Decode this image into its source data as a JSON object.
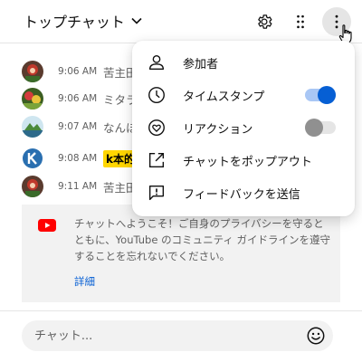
{
  "header": {
    "title": "トップチャット",
    "icons": [
      "chevron-down-icon",
      "gear-icon",
      "apps-grid-icon",
      "more-vert-icon"
    ]
  },
  "messages": [
    {
      "time": "9:06 AM",
      "author": "苦主田"
    },
    {
      "time": "9:06 AM",
      "author": "ミタラ"
    },
    {
      "time": "9:07 AM",
      "author": "なんほ"
    },
    {
      "time": "9:08 AM",
      "author": "k本的"
    },
    {
      "time": "9:11 AM",
      "author": "苦主田"
    }
  ],
  "welcome": {
    "text": "チャットへようこそ！ご自身のプライバシーを守るとともに、YouTube のコミュニティ ガイドラインを遵守することを忘れないでください。",
    "details_link": "詳細"
  },
  "input": {
    "placeholder": "チャット..."
  },
  "menu": {
    "items": [
      {
        "label": "参加者",
        "icon": "person-icon"
      },
      {
        "label": "タイムスタンプ",
        "icon": "clock-icon",
        "toggle": true
      },
      {
        "label": "リアクション",
        "icon": "heart-icon",
        "toggle": false
      },
      {
        "label": "チャットをポップアウト",
        "icon": "popout-icon"
      },
      {
        "label": "フィードバックを送信",
        "icon": "feedback-icon"
      }
    ]
  },
  "colors": {
    "accent": "#065fd4",
    "badge": "#ffd600",
    "youtube_red": "#ff0000",
    "welcome_bg": "#f2f2f2"
  }
}
